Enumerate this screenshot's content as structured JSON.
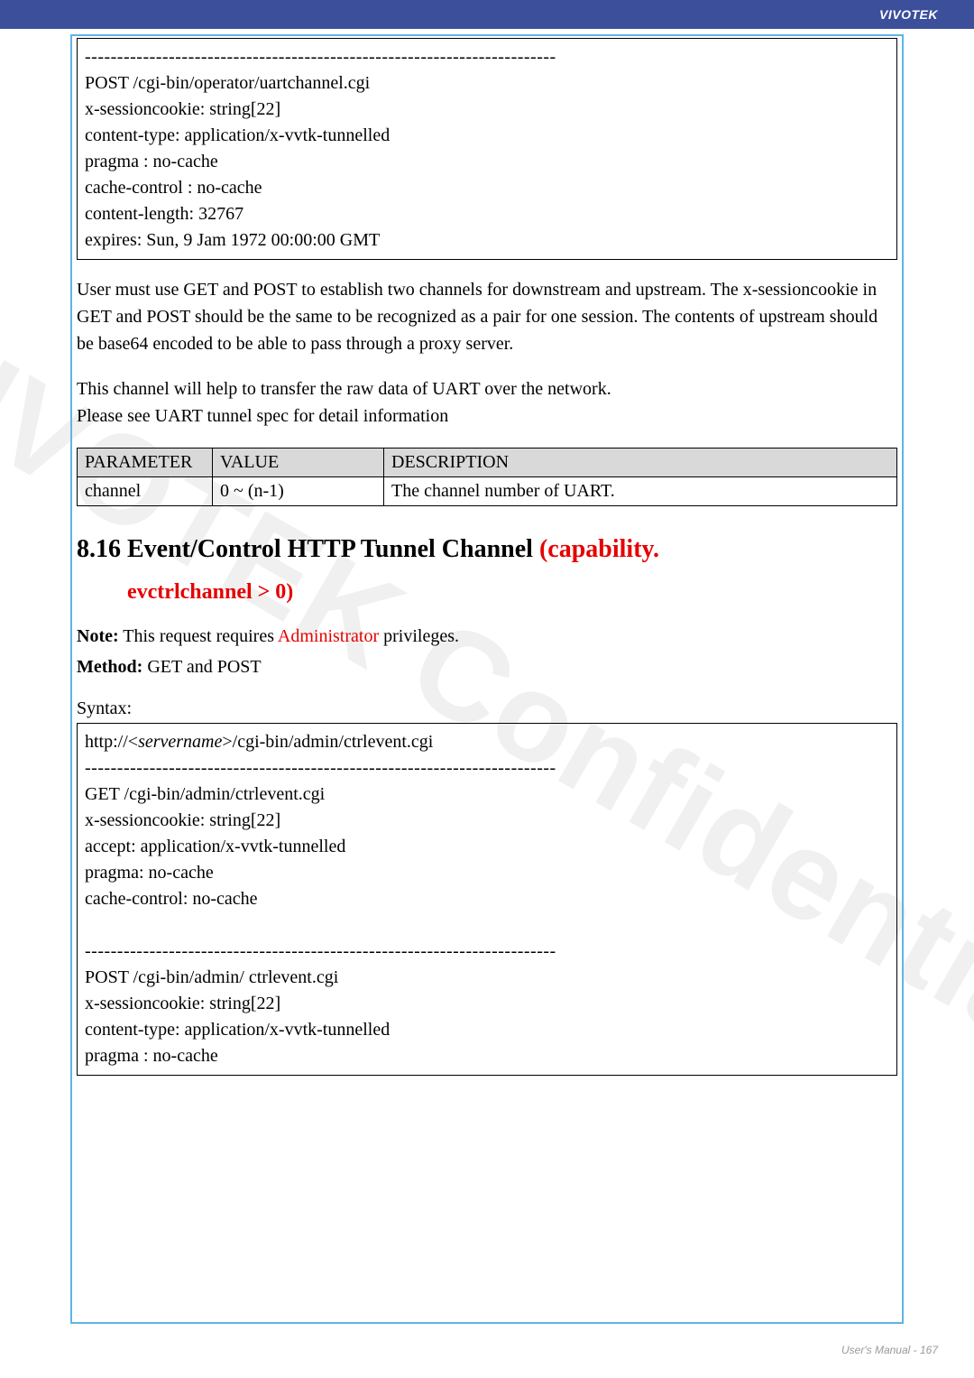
{
  "brand": "VIVOTEK",
  "codebox1": {
    "sep": "-------------------------------------------------------------------------",
    "l1": "POST /cgi-bin/operator/uartchannel.cgi",
    "l2": "x-sessioncookie: string[22]",
    "l3": "content-type: application/x-vvtk-tunnelled",
    "l4": "pragma : no-cache",
    "l5": "cache-control : no-cache",
    "l6": "content-length: 32767",
    "l7": "expires: Sun, 9 Jam 1972 00:00:00 GMT"
  },
  "para1": "User must use GET and POST to establish two channels for downstream and upstream. The x-sessioncookie in GET and POST should be the same to be recognized as a pair for one session. The contents of upstream should be base64 encoded to be able to pass through a proxy server.",
  "para2a": "This channel will help to transfer the raw data of UART over the network.",
  "para2b": "Please see UART tunnel spec for detail information",
  "table": {
    "h1": "PARAMETER",
    "h2": "VALUE",
    "h3": "DESCRIPTION",
    "r1c1": "channel",
    "r1c2": "0 ~ (n-1)",
    "r1c3": "The channel number of UART."
  },
  "section": {
    "num_title": "8.16 Event/Control HTTP Tunnel Channel ",
    "cap": "(capability.",
    "sub": "evctrlchannel > 0)"
  },
  "note": {
    "label": "Note:",
    "text1": " This request requires ",
    "adm": "Administrator",
    "text2": " privileges."
  },
  "method": {
    "label": "Method:",
    "text": " GET and POST"
  },
  "syntax": "Syntax:",
  "codebox2": {
    "prefix": "http://<",
    "srv": "servername",
    "suffix": ">/cgi-bin/admin/ctrlevent.cgi",
    "sep": "-------------------------------------------------------------------------",
    "l1": "GET /cgi-bin/admin/ctrlevent.cgi",
    "l2": "x-sessioncookie: string[22]",
    "l3": "accept: application/x-vvtk-tunnelled",
    "l4": "pragma: no-cache",
    "l5": "cache-control: no-cache",
    "p1": "POST /cgi-bin/admin/ ctrlevent.cgi",
    "p2": "x-sessioncookie: string[22]",
    "p3": "content-type: application/x-vvtk-tunnelled",
    "p4": "pragma : no-cache"
  },
  "footer": "User's Manual - 167",
  "watermark": "VIVOTEK Confidential"
}
